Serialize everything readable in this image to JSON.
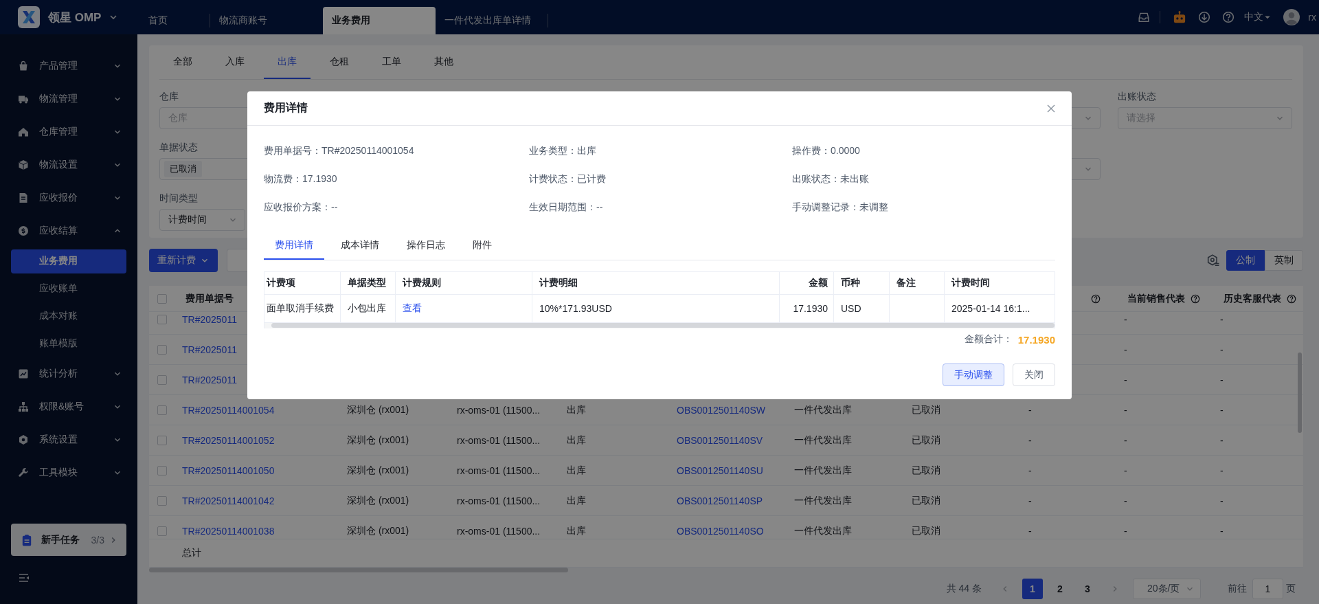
{
  "app": {
    "name": "领星 OMP"
  },
  "top_tabs": [
    {
      "label": "首页",
      "selected": false
    },
    {
      "label": "物流商账号",
      "selected": false
    },
    {
      "label": "业务费用",
      "selected": true
    },
    {
      "label": "一件代发出库单详情",
      "selected": false
    }
  ],
  "top_actions": {
    "language": "中文",
    "user": "rx"
  },
  "sidebar": {
    "items": [
      {
        "label": "产品管理",
        "expanded": false
      },
      {
        "label": "物流管理",
        "expanded": false
      },
      {
        "label": "仓库管理",
        "expanded": false
      },
      {
        "label": "物流设置",
        "expanded": false
      },
      {
        "label": "应收报价",
        "expanded": false
      },
      {
        "label": "应收结算",
        "expanded": true,
        "children": [
          {
            "label": "业务费用",
            "selected": true
          },
          {
            "label": "应收账单",
            "selected": false
          },
          {
            "label": "成本对账",
            "selected": false
          },
          {
            "label": "账单模版",
            "selected": false
          }
        ]
      },
      {
        "label": "统计分析",
        "expanded": false
      },
      {
        "label": "权限&账号",
        "expanded": false
      },
      {
        "label": "系统设置",
        "expanded": false
      },
      {
        "label": "工具模块",
        "expanded": false
      }
    ],
    "task": {
      "label": "新手任务",
      "progress": "3/3"
    }
  },
  "category_tabs": [
    {
      "label": "全部",
      "selected": false
    },
    {
      "label": "入库",
      "selected": false
    },
    {
      "label": "出库",
      "selected": true
    },
    {
      "label": "仓租",
      "selected": false
    },
    {
      "label": "工单",
      "selected": false
    },
    {
      "label": "其他",
      "selected": false
    }
  ],
  "filters": [
    {
      "label": "仓库",
      "kind": "input",
      "placeholder": "仓库"
    },
    {
      "kind": "select"
    },
    {
      "label": "出账状态",
      "kind": "select",
      "placeholder": "请选择"
    },
    {
      "label": "单据状态",
      "kind": "tags",
      "value": "已取消"
    },
    {
      "kind": "select"
    },
    {
      "label": "时间类型",
      "kind": "select",
      "value": "计费时间"
    }
  ],
  "toolbar": {
    "recalc": "重新计费",
    "units": [
      {
        "label": "公制",
        "selected": true
      },
      {
        "label": "英制",
        "selected": false
      }
    ]
  },
  "table": {
    "all_checked": false,
    "columns": [
      {
        "label": "费用单据号"
      },
      {
        "help": true
      },
      {
        "label": "当前销售代表",
        "help": true
      },
      {
        "label": "历史客服代表",
        "help": true
      }
    ],
    "rows": [
      {
        "checked": false,
        "fee_no": "TR#2025011",
        "sales_rep": "-",
        "cs_rep": "-"
      },
      {
        "checked": false,
        "fee_no": "TR#2025011",
        "sales_rep": "-",
        "cs_rep": "-"
      },
      {
        "checked": false,
        "fee_no": "TR#2025011",
        "sales_rep": "-",
        "cs_rep": "-"
      },
      {
        "checked": false,
        "fee_no": "TR#20250114001054",
        "column_2": "深圳仓 (rx001)",
        "column_3": "rx-oms-01 (11500...",
        "column_4": "出库",
        "column_5": "OBS0012501140SW",
        "column_6": "一件代发出库",
        "column_7": "已取消",
        "column_8": "-",
        "sales_rep": "-",
        "cs_rep": "-"
      },
      {
        "checked": false,
        "fee_no": "TR#20250114001052",
        "column_2": "深圳仓 (rx001)",
        "column_3": "rx-oms-01 (11500...",
        "column_4": "出库",
        "column_5": "OBS0012501140SV",
        "column_6": "一件代发出库",
        "column_7": "已取消",
        "column_8": "-",
        "sales_rep": "-",
        "cs_rep": "-"
      },
      {
        "checked": false,
        "fee_no": "TR#20250114001050",
        "column_2": "深圳仓 (rx001)",
        "column_3": "rx-oms-01 (11500...",
        "column_4": "出库",
        "column_5": "OBS0012501140SU",
        "column_6": "一件代发出库",
        "column_7": "已取消",
        "column_8": "-",
        "sales_rep": "-",
        "cs_rep": "-"
      },
      {
        "checked": false,
        "fee_no": "TR#20250114001042",
        "column_2": "深圳仓 (rx001)",
        "column_3": "rx-oms-01 (11500...",
        "column_4": "出库",
        "column_5": "OBS0012501140SP",
        "column_6": "一件代发出库",
        "column_7": "已取消",
        "column_8": "-",
        "sales_rep": "-",
        "cs_rep": "-"
      },
      {
        "checked": false,
        "fee_no": "TR#20250114001038",
        "column_2": "深圳仓 (rx001)",
        "column_3": "rx-oms-01 (11500...",
        "column_4": "出库",
        "column_5": "OBS0012501140SO",
        "column_6": "一件代发出库",
        "column_7": "已取消",
        "column_8": "-",
        "sales_rep": "-",
        "cs_rep": "-"
      }
    ],
    "total_label": "总计"
  },
  "pagination": {
    "total": "共 44 条",
    "pages": [
      {
        "label": "1",
        "selected": true
      },
      {
        "label": "2",
        "selected": false
      },
      {
        "label": "3",
        "selected": false
      }
    ],
    "page_size": "20条/页",
    "goto_label": "前往",
    "goto_value": "1",
    "page_unit": "页"
  },
  "modal": {
    "title": "费用详情",
    "fields": [
      {
        "label": "费用单据号：",
        "value": "TR#20250114001054"
      },
      {
        "label": "业务类型：",
        "value": "出库"
      },
      {
        "label": "操作费：",
        "value": "0.0000"
      },
      {
        "label": "物流费：",
        "value": "17.1930"
      },
      {
        "label": "计费状态：",
        "value": "已计费"
      },
      {
        "label": "出账状态：",
        "value": "未出账"
      },
      {
        "label": "应收报价方案：",
        "value": "--"
      },
      {
        "label": "生效日期范围：",
        "value": "--"
      },
      {
        "label": "手动调整记录：",
        "value": "未调整"
      }
    ],
    "tabs": [
      {
        "label": "费用详情",
        "selected": true
      },
      {
        "label": "成本详情",
        "selected": false
      },
      {
        "label": "操作日志",
        "selected": false
      },
      {
        "label": "附件",
        "selected": false
      }
    ],
    "table": {
      "columns": [
        "计费项",
        "单据类型",
        "计费规则",
        "计费明细",
        "金额",
        "币种",
        "备注",
        "计费时间"
      ],
      "rows": [
        {
          "item": "面单取消手续费",
          "doc_type": "小包出库",
          "rule": "查看",
          "detail": "10%*171.93USD",
          "amount": "17.1930",
          "currency": "USD",
          "time": "2025-01-14 16:1..."
        }
      ]
    },
    "total_label": "金额合计：",
    "total": "17.1930",
    "buttons": [
      {
        "label": "手动调整",
        "kind": "primary"
      },
      {
        "label": "关闭",
        "kind": "default"
      }
    ]
  }
}
